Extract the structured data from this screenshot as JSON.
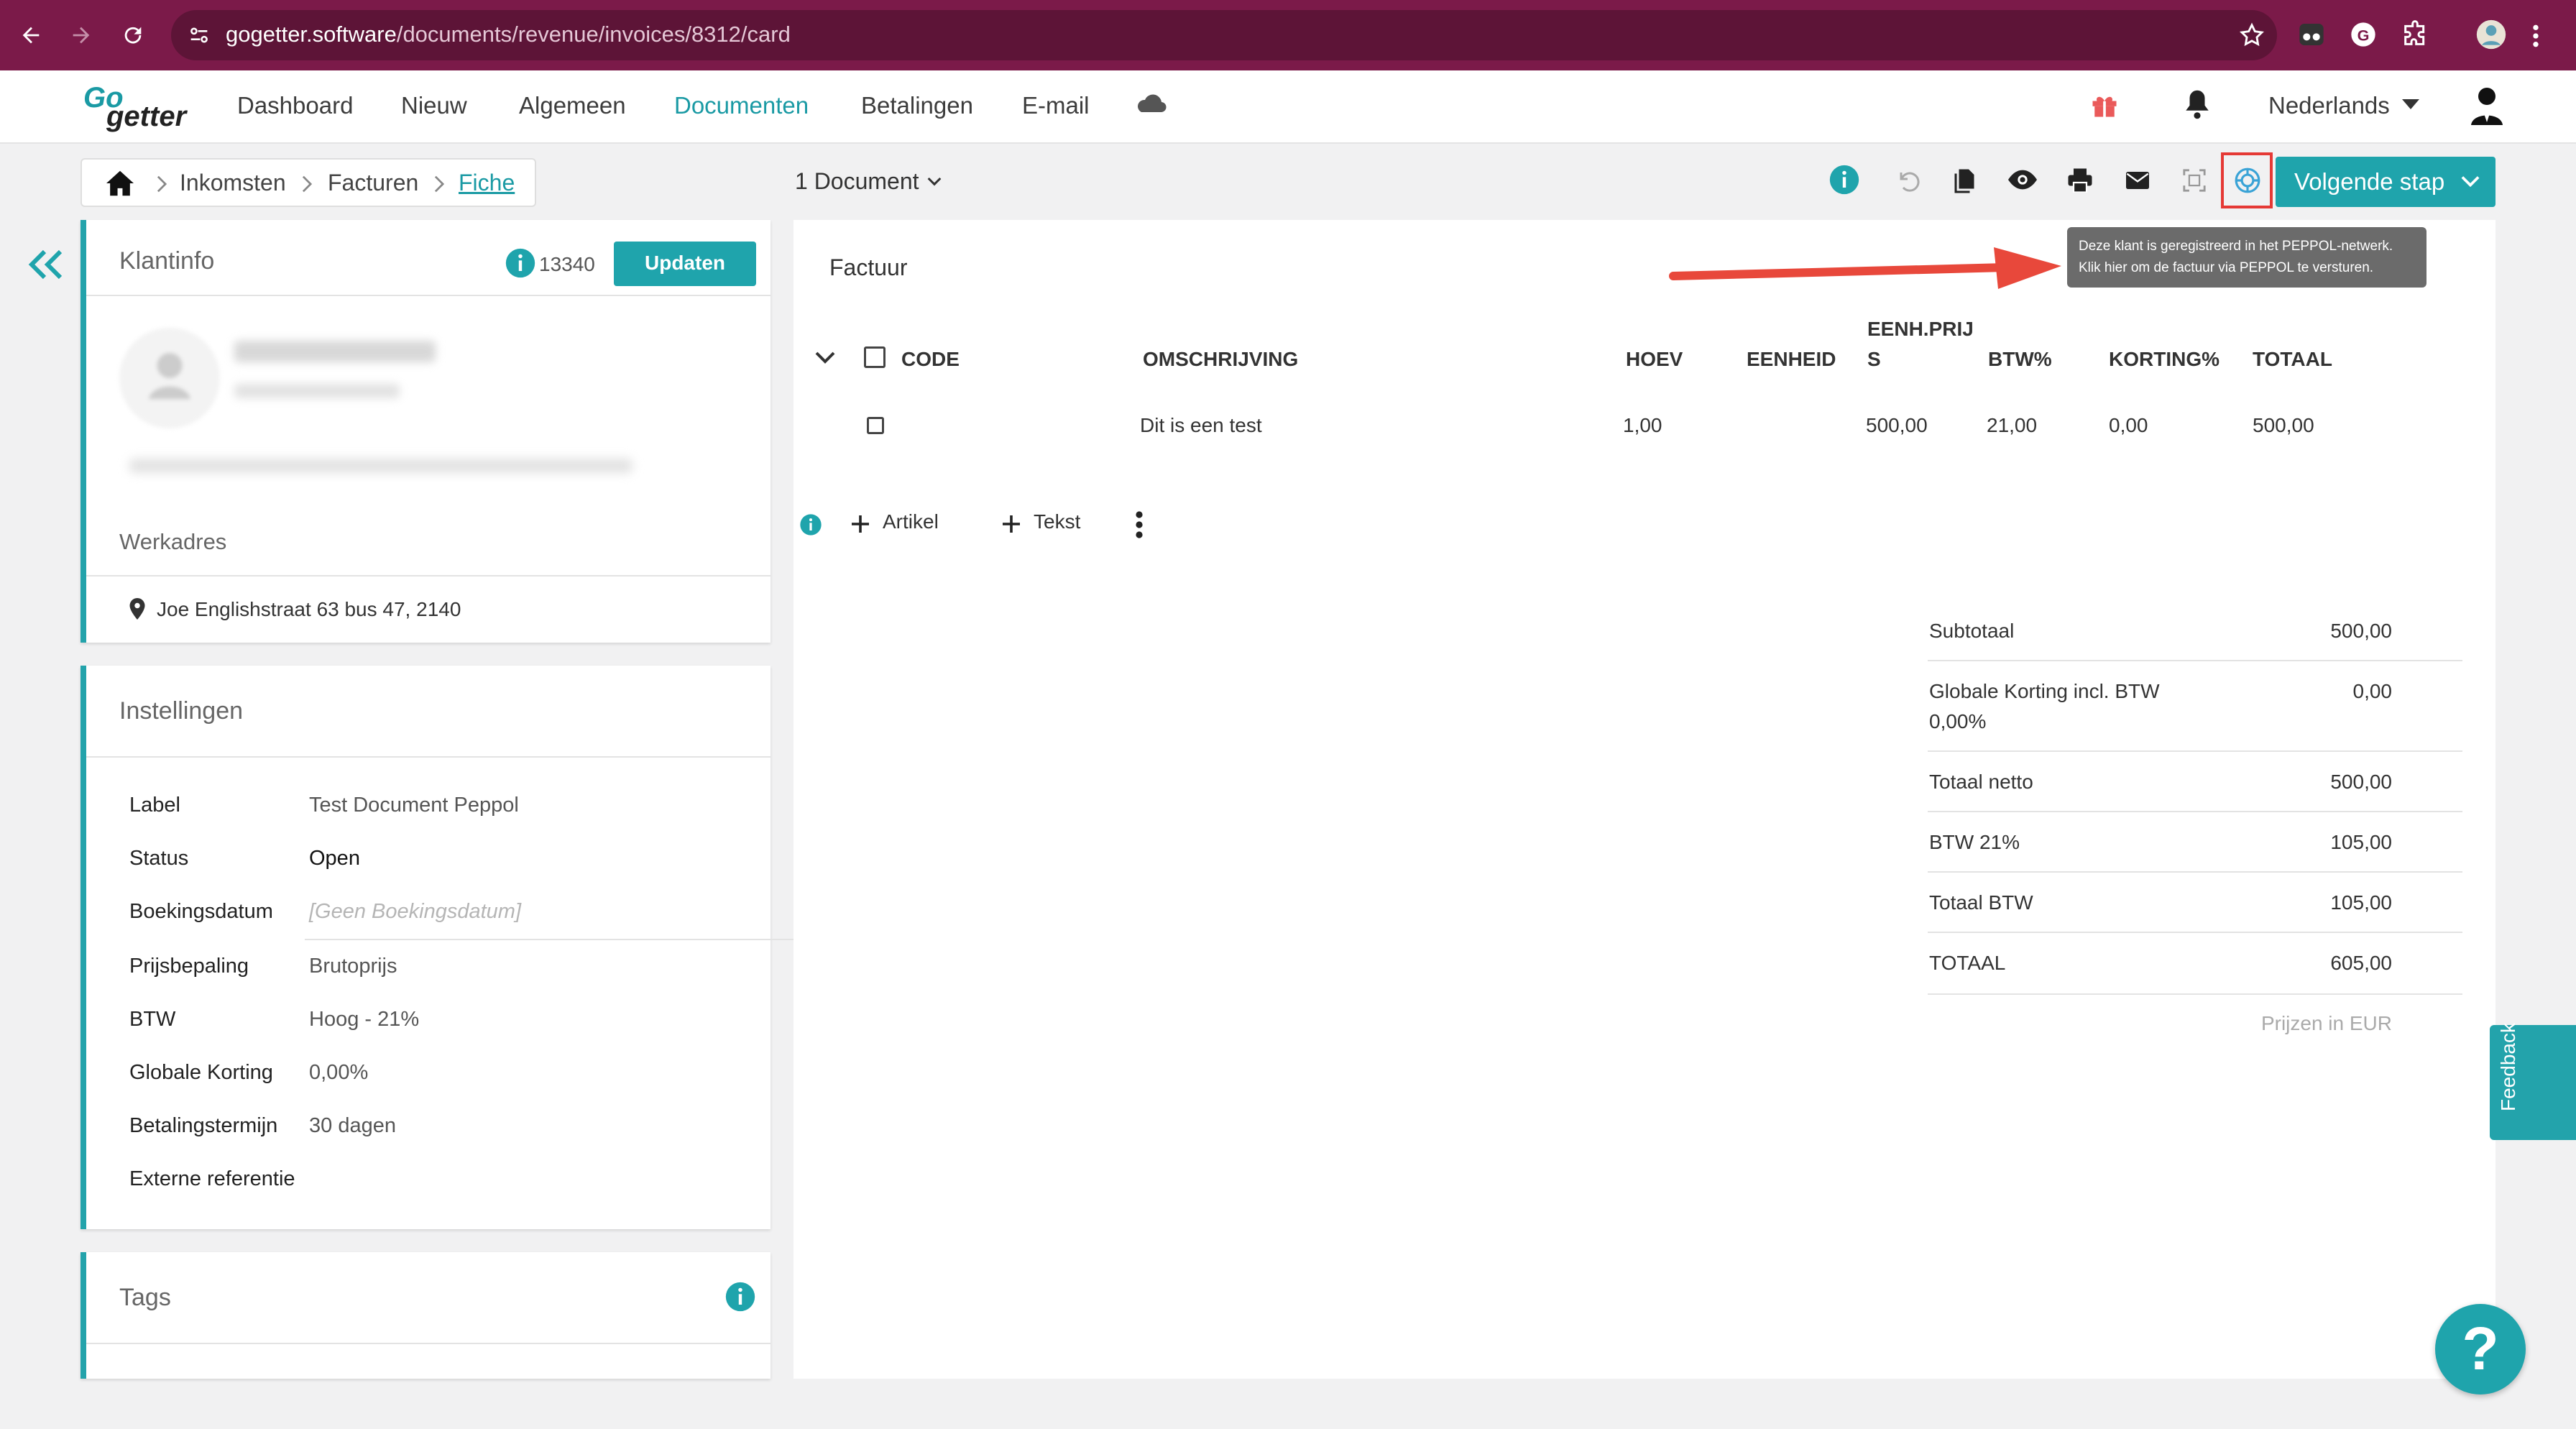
{
  "browser": {
    "url_host": "gogetter.software",
    "url_path": "/documents/revenue/invoices/8312/card"
  },
  "app": {
    "logo_top": "Go",
    "logo_bottom": "getter",
    "nav": [
      "Dashboard",
      "Nieuw",
      "Algemeen",
      "Documenten",
      "Betalingen",
      "E-mail"
    ],
    "active_nav": "Documenten",
    "language": "Nederlands"
  },
  "breadcrumb": [
    "Inkomsten",
    "Facturen",
    "Fiche"
  ],
  "toolbar": {
    "document_selector": "1 Document",
    "next_step": "Volgende stap"
  },
  "tooltip": {
    "line1": "Deze klant is geregistreerd in het PEPPOL-netwerk.",
    "line2": "Klik hier om de factuur via PEPPOL te versturen."
  },
  "klantinfo": {
    "title": "Klantinfo",
    "id": "13340",
    "update_button": "Updaten",
    "work_address_title": "Werkadres",
    "work_address": "Joe Englishstraat 63 bus 47, 2140"
  },
  "instellingen": {
    "title": "Instellingen",
    "rows": [
      {
        "label": "Label",
        "value": "Test Document Peppol"
      },
      {
        "label": "Status",
        "value": "Open"
      },
      {
        "label": "Boekingsdatum",
        "value": "[Geen Boekingsdatum]"
      },
      {
        "label": "Prijsbepaling",
        "value": "Brutoprijs"
      },
      {
        "label": "BTW",
        "value": "Hoog - 21%"
      },
      {
        "label": "Globale Korting",
        "value": "0,00%"
      },
      {
        "label": "Betalingstermijn",
        "value": "30 dagen"
      },
      {
        "label": "Externe referentie",
        "value": ""
      }
    ]
  },
  "tags": {
    "title": "Tags"
  },
  "document": {
    "title": "Factuur",
    "columns": {
      "code": "CODE",
      "description": "OMSCHRIJVING",
      "qty": "HOEV",
      "unit": "EENHEID",
      "unit_price_1": "EENH.PRIJ",
      "unit_price_2": "S",
      "vat": "BTW%",
      "discount": "KORTING%",
      "total": "TOTAAL"
    },
    "rows": [
      {
        "code": "",
        "description": "Dit is een test",
        "qty": "1,00",
        "unit": "",
        "unit_price": "500,00",
        "vat": "21,00",
        "discount": "0,00",
        "total": "500,00"
      }
    ],
    "add_article": "Artikel",
    "add_text": "Tekst"
  },
  "totals": {
    "rows": [
      {
        "label": "Subtotaal",
        "label2": "",
        "value": "500,00"
      },
      {
        "label": "Globale Korting incl. BTW",
        "label2": "0,00%",
        "value": "0,00"
      },
      {
        "label": "Totaal netto",
        "label2": "",
        "value": "500,00"
      },
      {
        "label": "BTW 21%",
        "label2": "",
        "value": "105,00"
      },
      {
        "label": "Totaal BTW",
        "label2": "",
        "value": "105,00"
      },
      {
        "label": "TOTAAL",
        "label2": "",
        "value": "605,00"
      }
    ],
    "currency_note": "Prijzen in EUR"
  },
  "feedback": "Feedback",
  "colors": {
    "brand_teal": "#1fa4ac",
    "browser_bar": "#7b1a49",
    "highlight_red": "#e53935",
    "arrow_red": "#e8483b"
  }
}
